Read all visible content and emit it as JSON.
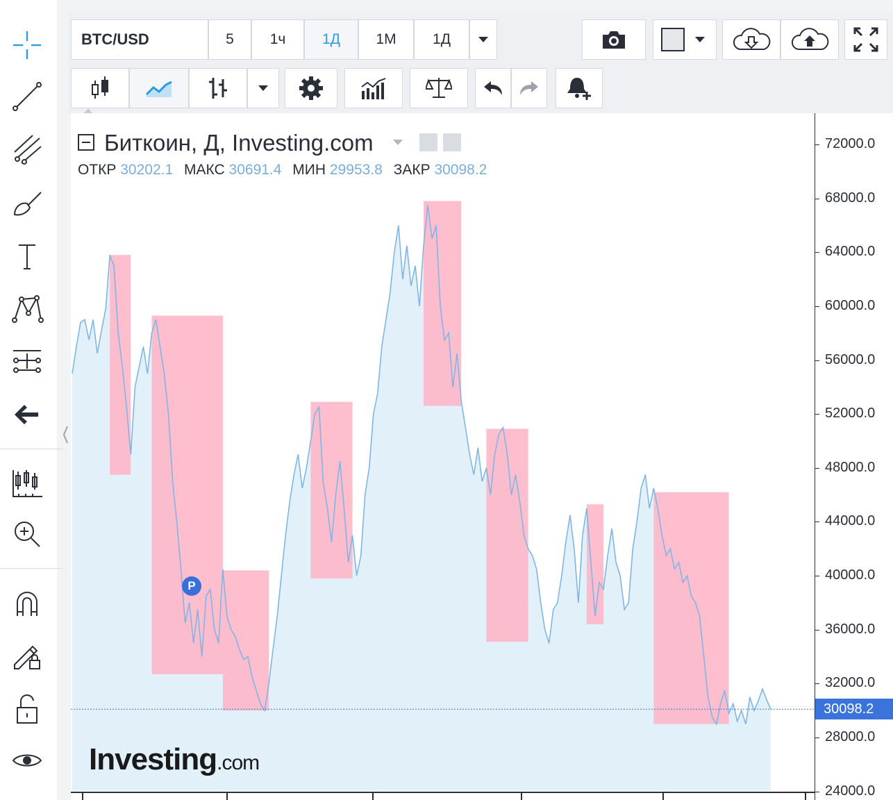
{
  "toolbar": {
    "symbol": "BTC/USD",
    "intervals": [
      "5",
      "1ч",
      "1Д",
      "1М",
      "1Д"
    ],
    "active_interval_index": 2
  },
  "sidebar": {
    "tools": [
      "crosshair-icon",
      "trend-line-icon",
      "pitchfork-icon",
      "brush-icon",
      "text-icon",
      "pattern-icon",
      "measure-icon",
      "back-arrow-icon",
      "ruler-icon",
      "zoom-in-icon",
      "magnet-icon",
      "lock-drawing-icon",
      "unlock-icon",
      "eye-icon"
    ]
  },
  "legend": {
    "title": "Биткоин, Д, Investing.com",
    "open_label": "ОТКР",
    "open": "30202.1",
    "high_label": "МАКС",
    "high": "30691.4",
    "low_label": "МИН",
    "low": "29953.8",
    "close_label": "ЗАКР",
    "close": "30098.2"
  },
  "price_axis": {
    "ticks": [
      "72000.0",
      "68000.0",
      "64000.0",
      "60000.0",
      "56000.0",
      "52000.0",
      "48000.0",
      "44000.0",
      "40000.0",
      "36000.0",
      "32000.0",
      "28000.0",
      "24000.0"
    ],
    "last_price": "30098.2"
  },
  "marker_label": "P",
  "watermark": {
    "brand": "Investing",
    "suffix": ".com"
  },
  "colors": {
    "line": "#7fb6e6",
    "area": "#e2f0fa",
    "highlight": "#ffb3c6",
    "accent": "#2d9be0",
    "price_tag": "#3a74db"
  },
  "chart_data": {
    "type": "area",
    "title": "Биткоин, Д, Investing.com",
    "ylim": [
      24000,
      73000
    ],
    "y_ticks": [
      24000,
      28000,
      32000,
      36000,
      40000,
      44000,
      48000,
      52000,
      56000,
      60000,
      64000,
      68000,
      72000
    ],
    "last": 30098.2,
    "series": [
      {
        "values": [
          55000,
          57000,
          58800,
          59000,
          57500,
          59000,
          56500,
          58200,
          59800,
          63800,
          63000,
          58000,
          55500,
          52500,
          49000,
          54000,
          55500,
          57000,
          55000,
          58000,
          59000,
          57000,
          55000,
          52000,
          47000,
          44000,
          40500,
          36500,
          38000,
          35000,
          37500,
          34000,
          38500,
          39000,
          36000,
          35000,
          40500,
          37000,
          36000,
          35500,
          34500,
          33800,
          34000,
          32500,
          31500,
          30500,
          30000,
          32000,
          34500,
          37000,
          40000,
          43000,
          45500,
          47500,
          49000,
          46500,
          48000,
          50000,
          52000,
          52500,
          47000,
          45000,
          42500,
          46000,
          48500,
          45000,
          41000,
          43000,
          40000,
          41500,
          46000,
          48000,
          52000,
          53500,
          57000,
          59000,
          61000,
          64000,
          66000,
          62000,
          64500,
          61500,
          63000,
          60000,
          64500,
          67500,
          65000,
          66000,
          60000,
          57500,
          58000,
          54000,
          56500,
          53000,
          51000,
          49000,
          47500,
          49500,
          47000,
          48000,
          46000,
          49000,
          50500,
          51000,
          49000,
          46000,
          47500,
          45500,
          43000,
          42000,
          41500,
          40500,
          38000,
          36000,
          35000,
          37500,
          38000,
          40000,
          42500,
          44500,
          42000,
          38000,
          43000,
          45000,
          41000,
          37000,
          39500,
          39000,
          41500,
          43500,
          41000,
          40000,
          37500,
          38000,
          42000,
          44000,
          46500,
          47500,
          45000,
          46500,
          45000,
          43000,
          41500,
          42000,
          40500,
          41000,
          39500,
          40000,
          38500,
          38000,
          37000,
          34000,
          31000,
          29500,
          29000,
          30500,
          31500,
          29800,
          30500,
          29200,
          30000,
          29000,
          31000,
          30000,
          30700,
          31600,
          30800,
          30098
        ]
      }
    ]
  }
}
